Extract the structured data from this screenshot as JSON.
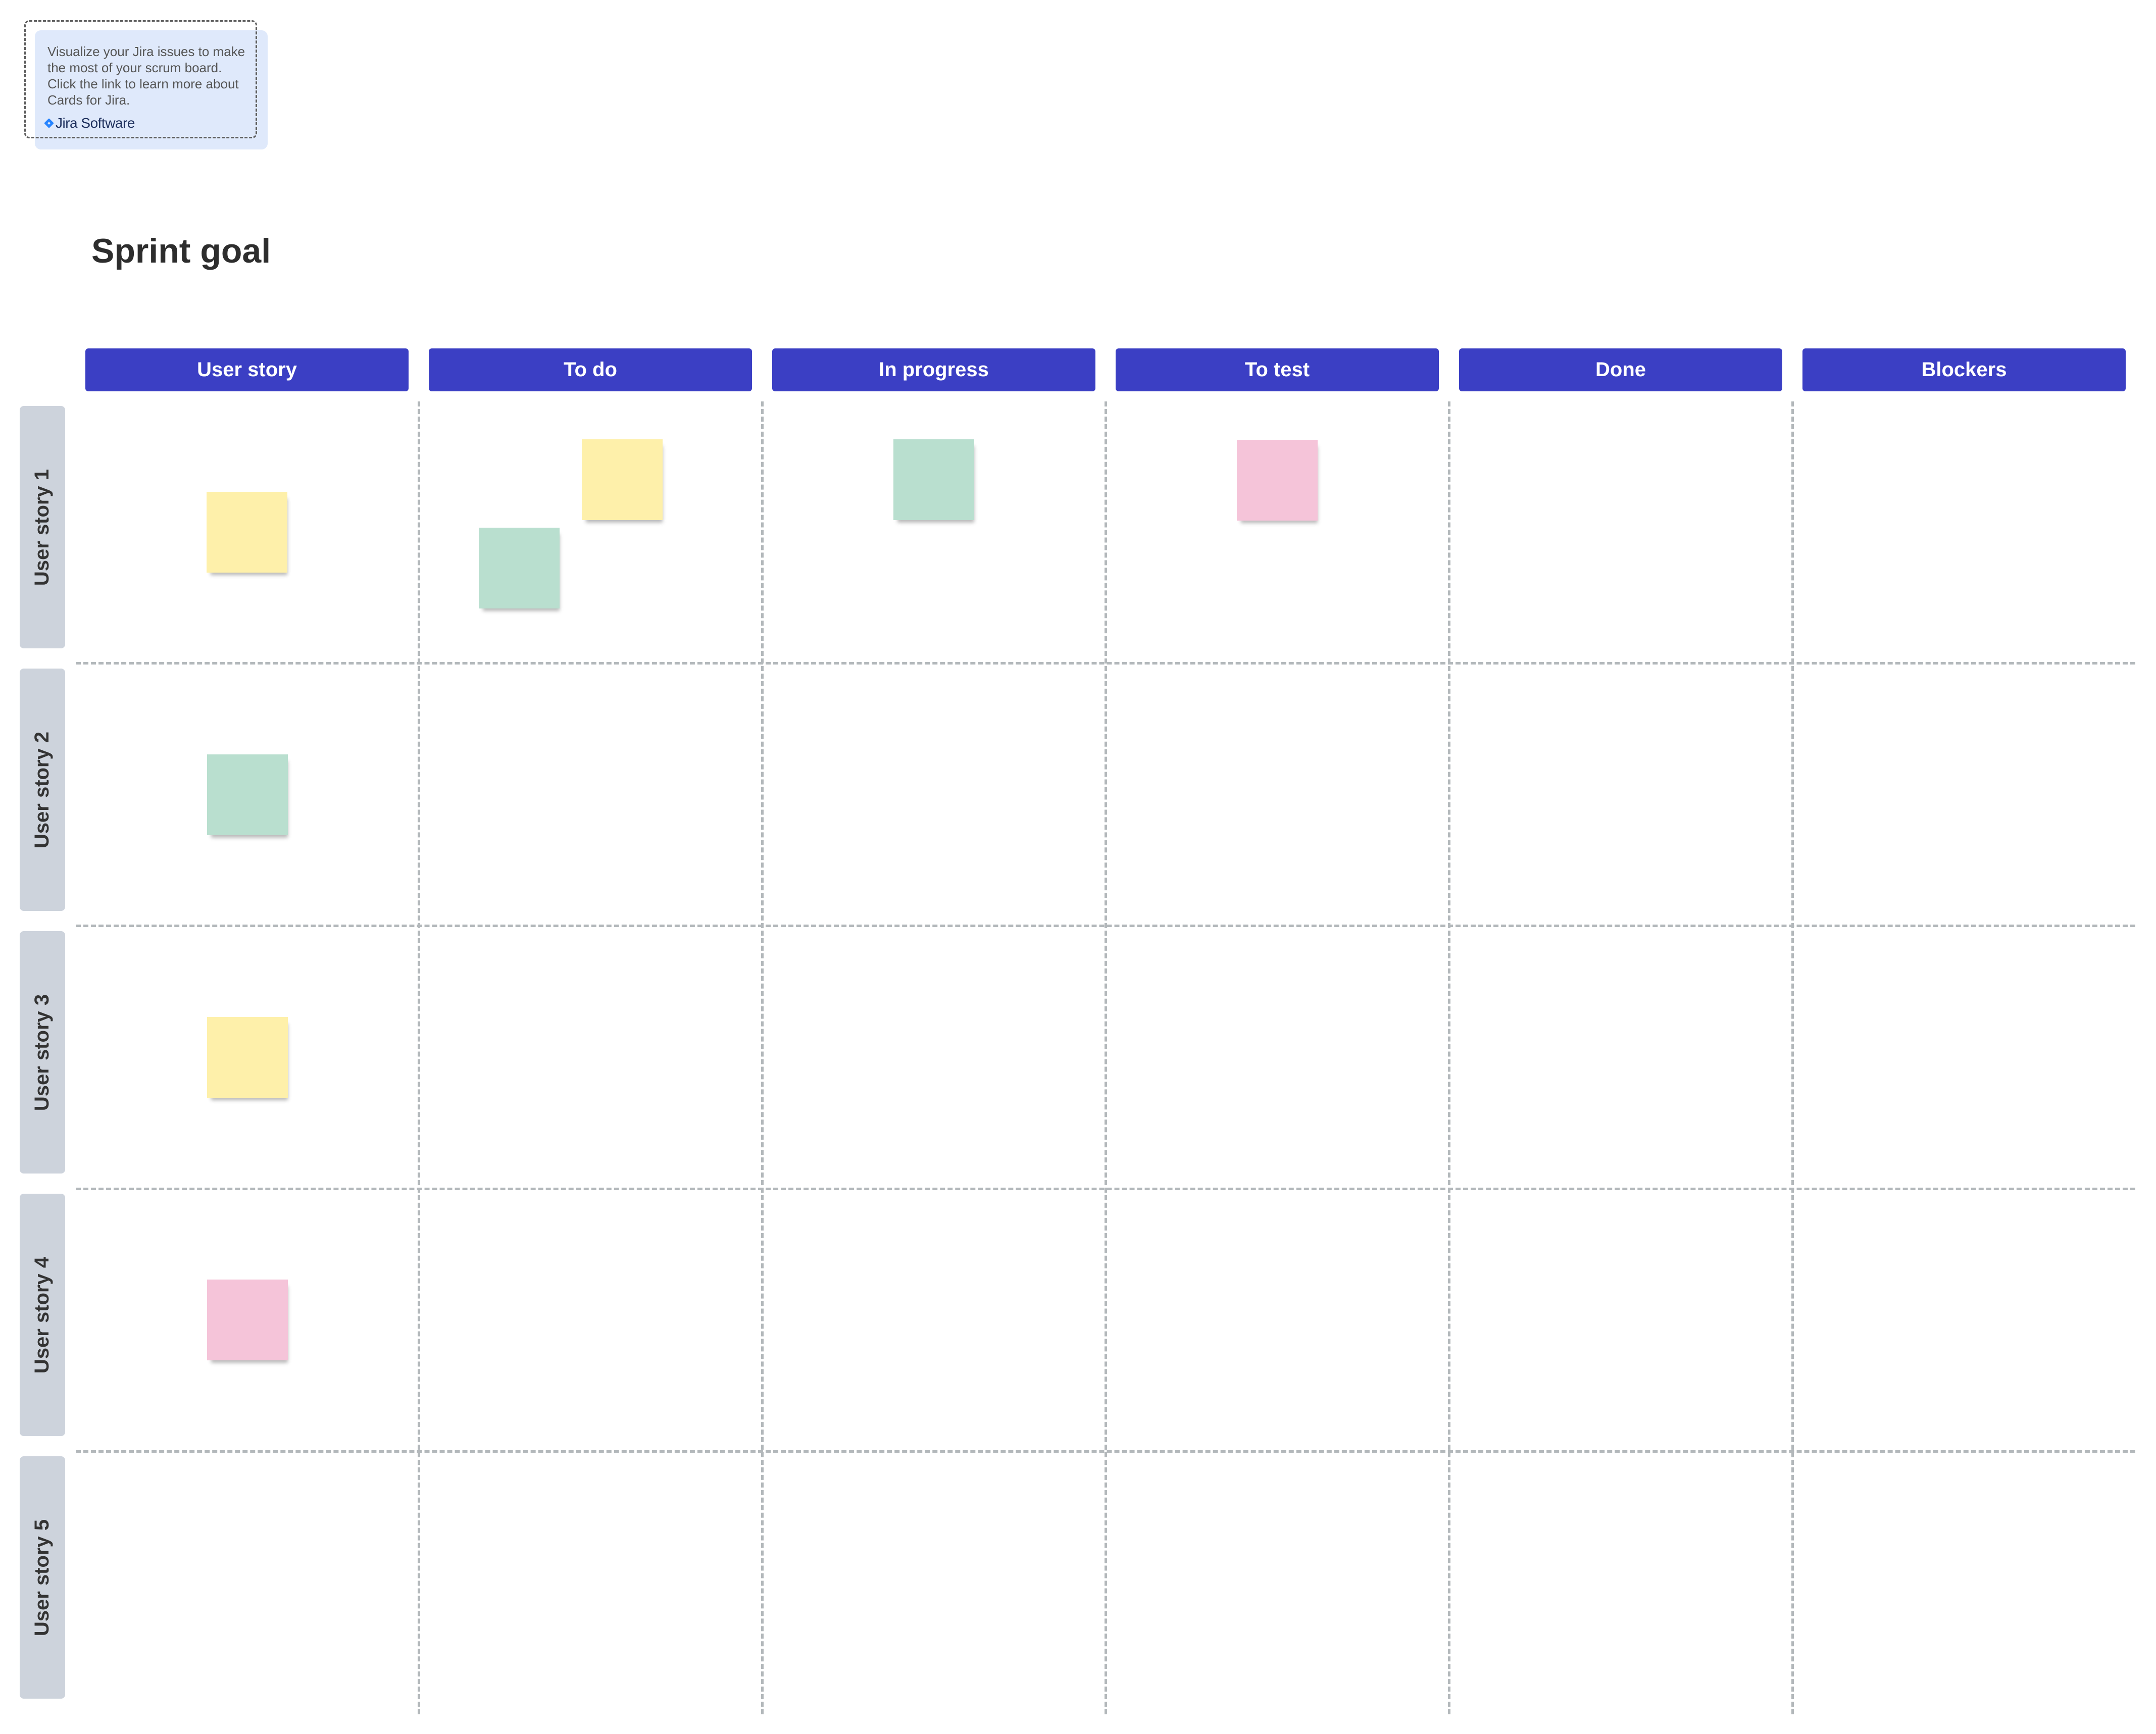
{
  "info_card": {
    "text": "Visualize your Jira issues to make the most of your scrum board. Click the link to learn more about Cards for Jira.",
    "logo_label": "Jira Software",
    "logo_icon": "jira-diamond-icon"
  },
  "board": {
    "title": "Sprint goal",
    "columns": [
      {
        "label": "User story"
      },
      {
        "label": "To do"
      },
      {
        "label": "In progress"
      },
      {
        "label": "To test"
      },
      {
        "label": "Done"
      },
      {
        "label": "Blockers"
      }
    ],
    "rows": [
      {
        "label": "User story 1"
      },
      {
        "label": "User story 2"
      },
      {
        "label": "User story 3"
      },
      {
        "label": "User story 4"
      },
      {
        "label": "User story 5"
      }
    ],
    "header_color": "#3b3fc4",
    "sticky_colors": {
      "yellow": "#fef0aa",
      "green": "#b9dfcf",
      "pink": "#f5c4d9"
    },
    "stickies": [
      {
        "row": "User story 1",
        "column": "User story",
        "color": "yellow"
      },
      {
        "row": "User story 1",
        "column": "To do",
        "color": "green"
      },
      {
        "row": "User story 1",
        "column": "To do",
        "color": "yellow"
      },
      {
        "row": "User story 1",
        "column": "In progress",
        "color": "green"
      },
      {
        "row": "User story 1",
        "column": "To test",
        "color": "pink"
      },
      {
        "row": "User story 2",
        "column": "User story",
        "color": "green"
      },
      {
        "row": "User story 3",
        "column": "User story",
        "color": "yellow"
      },
      {
        "row": "User story 4",
        "column": "User story",
        "color": "pink"
      }
    ]
  }
}
